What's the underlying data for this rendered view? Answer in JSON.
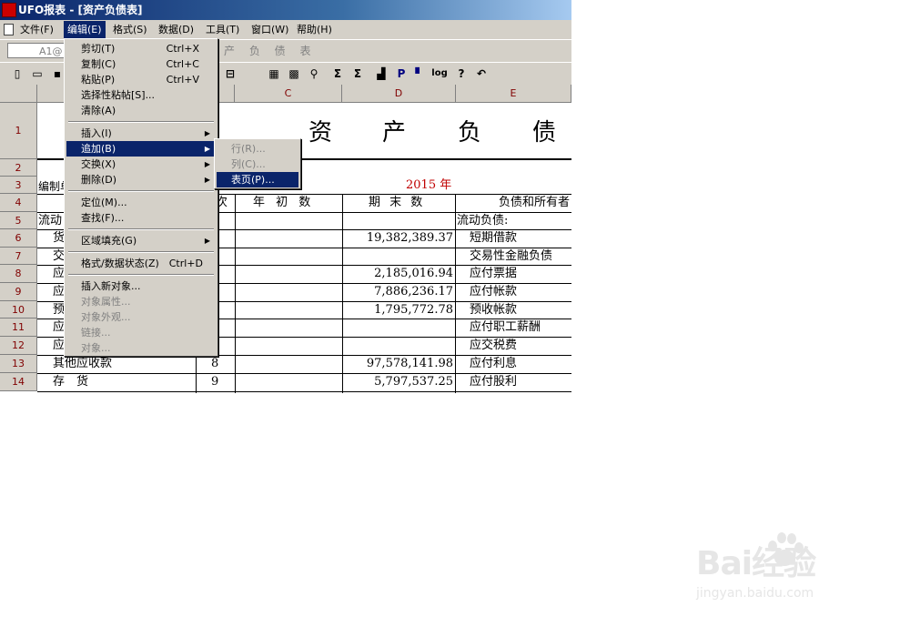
{
  "window": {
    "title": "UFO报表 - [资产负债表]"
  },
  "menubar": [
    {
      "label": "文件(F)"
    },
    {
      "label": "编辑(E)",
      "active": true
    },
    {
      "label": "格式(S)"
    },
    {
      "label": "数据(D)"
    },
    {
      "label": "工具(T)"
    },
    {
      "label": "窗口(W)"
    },
    {
      "label": "帮助(H)"
    }
  ],
  "formula_bar": {
    "cell_ref": "A1@",
    "content": "产 负 债 表"
  },
  "toolbar": {
    "icons": [
      "new-icon",
      "open-icon",
      "save-icon",
      "insert-row-icon",
      "format-icon",
      "table-icon",
      "find-icon",
      "sum-icon",
      "sort-icon",
      "chart-icon",
      "print-preview-icon",
      "log-icon",
      "help-icon",
      "undo-icon"
    ],
    "labels": {
      "p": "P",
      "log": "log"
    }
  },
  "sheet": {
    "columns": [
      {
        "label": ""
      },
      {
        "label": "C"
      },
      {
        "label": "D"
      },
      {
        "label": "E"
      }
    ],
    "rows": [
      "1",
      "2",
      "3",
      "4",
      "5",
      "6",
      "7",
      "8",
      "9",
      "10",
      "11",
      "12",
      "13",
      "14"
    ],
    "title_chars": [
      "资",
      "产",
      "负",
      "债"
    ],
    "year": "2015 年",
    "row3_left": "编制单",
    "header": {
      "col_b": "次",
      "col_c": "年 初 数",
      "col_d": "期 末 数",
      "col_e": "负债和所有者"
    },
    "cells": [
      {
        "row": "5",
        "a": "流动",
        "b": "",
        "c": "",
        "d": "",
        "e": "流动负债:"
      },
      {
        "row": "6",
        "a": "货",
        "b": "",
        "c": "",
        "d": "19,382,389.37",
        "e": "短期借款"
      },
      {
        "row": "7",
        "a": "交",
        "b": "",
        "c": "",
        "d": "",
        "e": "交易性金融负债"
      },
      {
        "row": "8",
        "a": "应",
        "b": "",
        "c": "",
        "d": "2,185,016.94",
        "e": "应付票据"
      },
      {
        "row": "9",
        "a": "应",
        "b": "",
        "c": "",
        "d": "7,886,236.17",
        "e": "应付帐款"
      },
      {
        "row": "10",
        "a": "预",
        "b": "",
        "c": "",
        "d": "1,795,772.78",
        "e": "预收帐款"
      },
      {
        "row": "11",
        "a": "应",
        "b": "",
        "c": "",
        "d": "",
        "e": "应付职工薪酬"
      },
      {
        "row": "12",
        "a": "应",
        "b": "",
        "c": "",
        "d": "",
        "e": "应交税费"
      },
      {
        "row": "13",
        "a": "其他应收款",
        "b": "8",
        "c": "",
        "d": "97,578,141.98",
        "e": "应付利息"
      },
      {
        "row": "14",
        "a": "存　货",
        "b": "9",
        "c": "",
        "d": "5,797,537.25",
        "e": "应付股利"
      }
    ]
  },
  "edit_menu": {
    "items": [
      {
        "label": "剪切(T)",
        "shortcut": "Ctrl+X"
      },
      {
        "label": "复制(C)",
        "shortcut": "Ctrl+C"
      },
      {
        "label": "粘贴(P)",
        "shortcut": "Ctrl+V"
      },
      {
        "label": "选择性粘帖[S]...",
        "shortcut": ""
      },
      {
        "label": "清除(A)",
        "shortcut": ""
      },
      {
        "label": "插入(I)",
        "submenu": true
      },
      {
        "label": "追加(B)",
        "submenu": true,
        "highlighted": true
      },
      {
        "label": "交换(X)",
        "submenu": true
      },
      {
        "label": "删除(D)",
        "submenu": true
      },
      {
        "label": "定位(M)...",
        "shortcut": ""
      },
      {
        "label": "查找(F)...",
        "shortcut": ""
      },
      {
        "label": "区域填充(G)",
        "submenu": true
      },
      {
        "label": "格式/数据状态(Z)",
        "shortcut": "Ctrl+D"
      },
      {
        "label": "插入新对象...",
        "shortcut": ""
      },
      {
        "label": "对象属性...",
        "disabled": true
      },
      {
        "label": "对象外观...",
        "disabled": true
      },
      {
        "label": "链接...",
        "disabled": true
      },
      {
        "label": "对象...",
        "disabled": true
      }
    ]
  },
  "append_submenu": {
    "items": [
      {
        "label": "行(R)...",
        "disabled": true
      },
      {
        "label": "列(C)...",
        "disabled": true
      },
      {
        "label": "表页(P)...",
        "highlighted": true
      }
    ]
  },
  "watermark": {
    "brand": "Bai经验",
    "url": "jingyan.baidu.com"
  },
  "colors": {
    "title_blue": "#0a246a",
    "highlight": "#0a246a",
    "face": "#d4d0c8",
    "year_red": "#c00000"
  }
}
